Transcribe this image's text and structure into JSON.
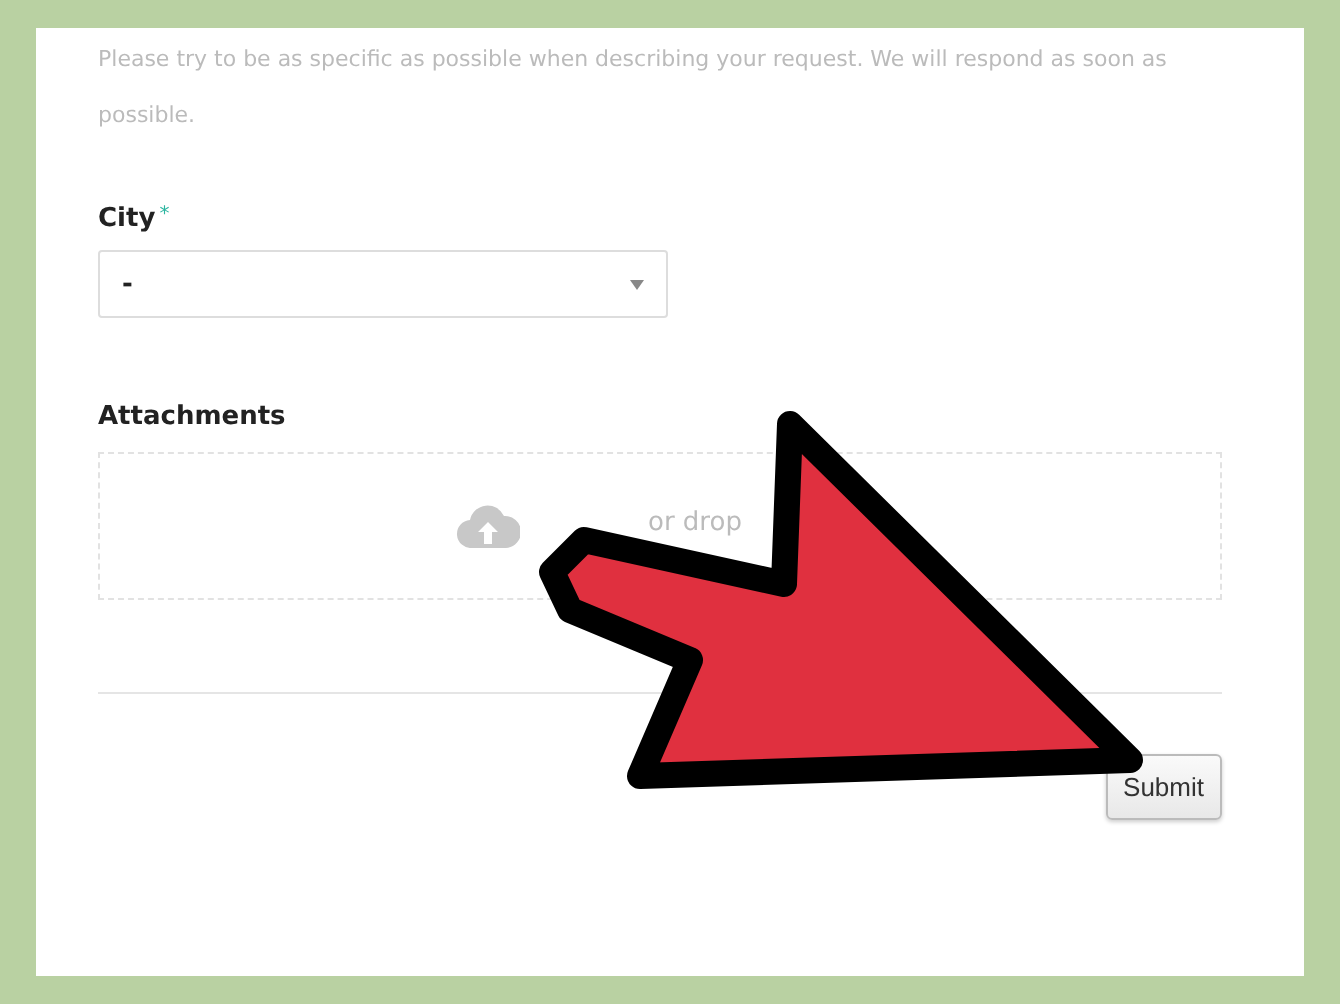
{
  "description": "Please try to be as specific as possible when describing your request. We will respond as soon as possible.",
  "city": {
    "label": "City",
    "required_mark": "*",
    "value": "-"
  },
  "attachments": {
    "label": "Attachments",
    "drop_text": "or drop"
  },
  "submit": "Submit"
}
